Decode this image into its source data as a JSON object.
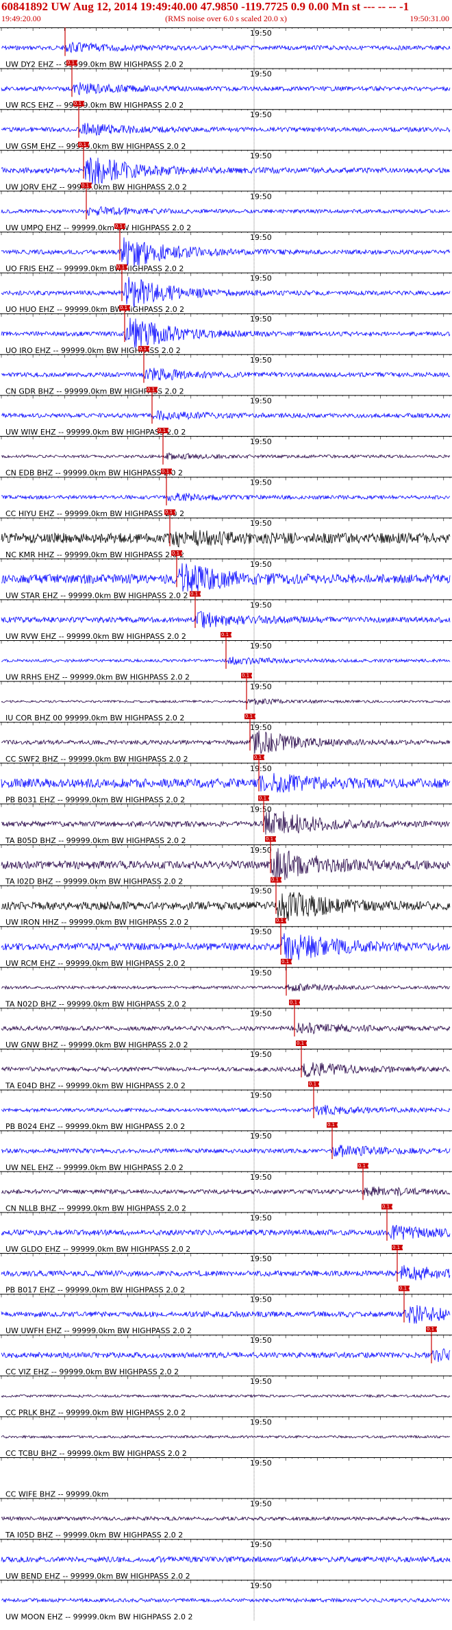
{
  "header": {
    "title": "60841892 UW Aug 12, 2014 19:49:40.00   47.9850 -119.7725  0.9 0.00 Mn st --- -- --  -1",
    "subtitle": "(RMS noise over 6.0 s scaled 20.0 x)",
    "start_time": "19:49:20.00",
    "end_time": "19:50:31.00"
  },
  "chart_data": {
    "type": "line",
    "minute_label": "19:50",
    "traces": [
      {
        "label": "UW DY2 EHZ -- 99999.0km BW  HIGHPASS  2.0  2",
        "color": "#0000ff",
        "pick": "0.1 e"
      },
      {
        "label": "UW RCS EHZ -- 99999.0km BW  HIGHPASS  2.0  2",
        "color": "#0000ff",
        "pick": "0.1 e"
      },
      {
        "label": "UW GSM EHZ -- 99999.0km BW  HIGHPASS  2.0  2",
        "color": "#0000ff",
        "pick": "0.1 e"
      },
      {
        "label": "UW JORV EHZ -- 99999.0km BW  HIGHPASS  2.0  2",
        "color": "#0000ff",
        "pick": "0.1 e"
      },
      {
        "label": "UW UMPQ EHZ -- 99999.0km BW  HIGHPASS  2.0  2",
        "color": "#0000ff",
        "pick": "0.1 e"
      },
      {
        "label": "UO FRIS EHZ -- 99999.0km BW  HIGHPASS  2.0  2",
        "color": "#0000ff",
        "pick": "0.1 e"
      },
      {
        "label": "UO HUO EHZ -- 99999.0km BW  HIGHPASS  2.0  2",
        "color": "#0000ff",
        "pick": "0.1 e"
      },
      {
        "label": "UO IRO EHZ -- 99999.0km BW  HIGHPASS  2.0  2",
        "color": "#0000ff",
        "pick": "0.1 e"
      },
      {
        "label": "CN GDR BHZ -- 99999.0km BW  HIGHPASS  2.0  2",
        "color": "#0000ff",
        "pick": "0.1 e"
      },
      {
        "label": "UW WIW EHZ -- 99999.0km BW  HIGHPASS  2.0  2",
        "color": "#0000ff",
        "pick": "0.1 e"
      },
      {
        "label": "CN EDB BHZ -- 99999.0km BW  HIGHPASS  2.0  2",
        "color": "#220044",
        "pick": "0.1 e"
      },
      {
        "label": "CC HIYU EHZ -- 99999.0km BW  HIGHPASS  2.0  2",
        "color": "#0000ff",
        "pick": "0.1 e"
      },
      {
        "label": "NC KMR HHZ -- 99999.0km BW  HIGHPASS  2.0  2",
        "color": "#000000",
        "pick": "0.1 e"
      },
      {
        "label": "UW STAR EHZ -- 99999.0km BW  HIGHPASS  2.0  2",
        "color": "#0000ff",
        "pick": "0.1 e"
      },
      {
        "label": "UW RVW EHZ -- 99999.0km BW  HIGHPASS  2.0  2",
        "color": "#0000ff",
        "pick": "0.1 e"
      },
      {
        "label": "UW RRHS EHZ -- 99999.0km BW  HIGHPASS  2.0  2",
        "color": "#0000ff",
        "pick": "0.1 e"
      },
      {
        "label": "IU COR BHZ 00 99999.0km BW  HIGHPASS  2.0  2",
        "color": "#220044",
        "pick": "0.1 e"
      },
      {
        "label": "CC SWF2 BHZ -- 99999.0km BW  HIGHPASS  2.0  2",
        "color": "#220044",
        "pick": "0.1 e"
      },
      {
        "label": "PB B031 EHZ -- 99999.0km BW  HIGHPASS  2.0  2",
        "color": "#0000ff",
        "pick": "0.1 e"
      },
      {
        "label": "TA B05D BHZ -- 99999.0km BW  HIGHPASS  2.0  2",
        "color": "#220044",
        "pick": "0.1 e"
      },
      {
        "label": "TA I02D BHZ -- 99999.0km BW  HIGHPASS  2.0  2",
        "color": "#220044",
        "pick": "0.1 e"
      },
      {
        "label": "UW IRON HHZ -- 99999.0km BW  HIGHPASS  2.0  2",
        "color": "#000000",
        "pick": "0.1 e"
      },
      {
        "label": "UW RCM EHZ -- 99999.0km BW  HIGHPASS  2.0  2",
        "color": "#0000ff",
        "pick": "0.1 e"
      },
      {
        "label": "TA N02D BHZ -- 99999.0km BW  HIGHPASS  2.0  2",
        "color": "#220044",
        "pick": "0.1 e"
      },
      {
        "label": "UW GNW BHZ -- 99999.0km BW  HIGHPASS  2.0  2",
        "color": "#220044",
        "pick": "0.1 e"
      },
      {
        "label": "TA E04D BHZ -- 99999.0km BW  HIGHPASS  2.0  2",
        "color": "#220044",
        "pick": "0.1 e"
      },
      {
        "label": "PB B024 EHZ -- 99999.0km BW  HIGHPASS  2.0  2",
        "color": "#0000ff",
        "pick": "0.1 e"
      },
      {
        "label": "UW NEL EHZ -- 99999.0km BW  HIGHPASS  2.0  2",
        "color": "#0000ff",
        "pick": "0.1 e"
      },
      {
        "label": "CN NLLB BHZ -- 99999.0km BW  HIGHPASS  2.0  2",
        "color": "#220044",
        "pick": "0.1 e"
      },
      {
        "label": "UW GLDO EHZ -- 99999.0km BW  HIGHPASS  2.0  2",
        "color": "#0000ff",
        "pick": "0.1 e"
      },
      {
        "label": "PB B017 EHZ -- 99999.0km BW  HIGHPASS  2.0  2",
        "color": "#0000ff",
        "pick": "0.1 e"
      },
      {
        "label": "UW UWFH EHZ -- 99999.0km BW  HIGHPASS  2.0  2",
        "color": "#0000ff",
        "pick": "0.1 e"
      },
      {
        "label": "CC VIZ EHZ -- 99999.0km BW  HIGHPASS  2.0  2",
        "color": "#0000ff",
        "pick": "0.1 e"
      },
      {
        "label": "CC PRLK BHZ -- 99999.0km BW  HIGHPASS  2.0  2",
        "color": "#220044",
        "pick": ""
      },
      {
        "label": "CC TCBU BHZ -- 99999.0km BW  HIGHPASS  2.0  2",
        "color": "#220044",
        "pick": ""
      },
      {
        "label": "CC WIFE BHZ -- 99999.0km",
        "color": "#ffffff",
        "pick": ""
      },
      {
        "label": "TA I05D BHZ -- 99999.0km BW  HIGHPASS  2.0  2",
        "color": "#220044",
        "pick": ""
      },
      {
        "label": "UW BEND EHZ -- 99999.0km BW  HIGHPASS  2.0  2",
        "color": "#0000ff",
        "pick": ""
      },
      {
        "label": "UW MOON EHZ -- 99999.0km BW  HIGHPASS  2.0  2",
        "color": "#0000ff",
        "pick": ""
      }
    ]
  }
}
